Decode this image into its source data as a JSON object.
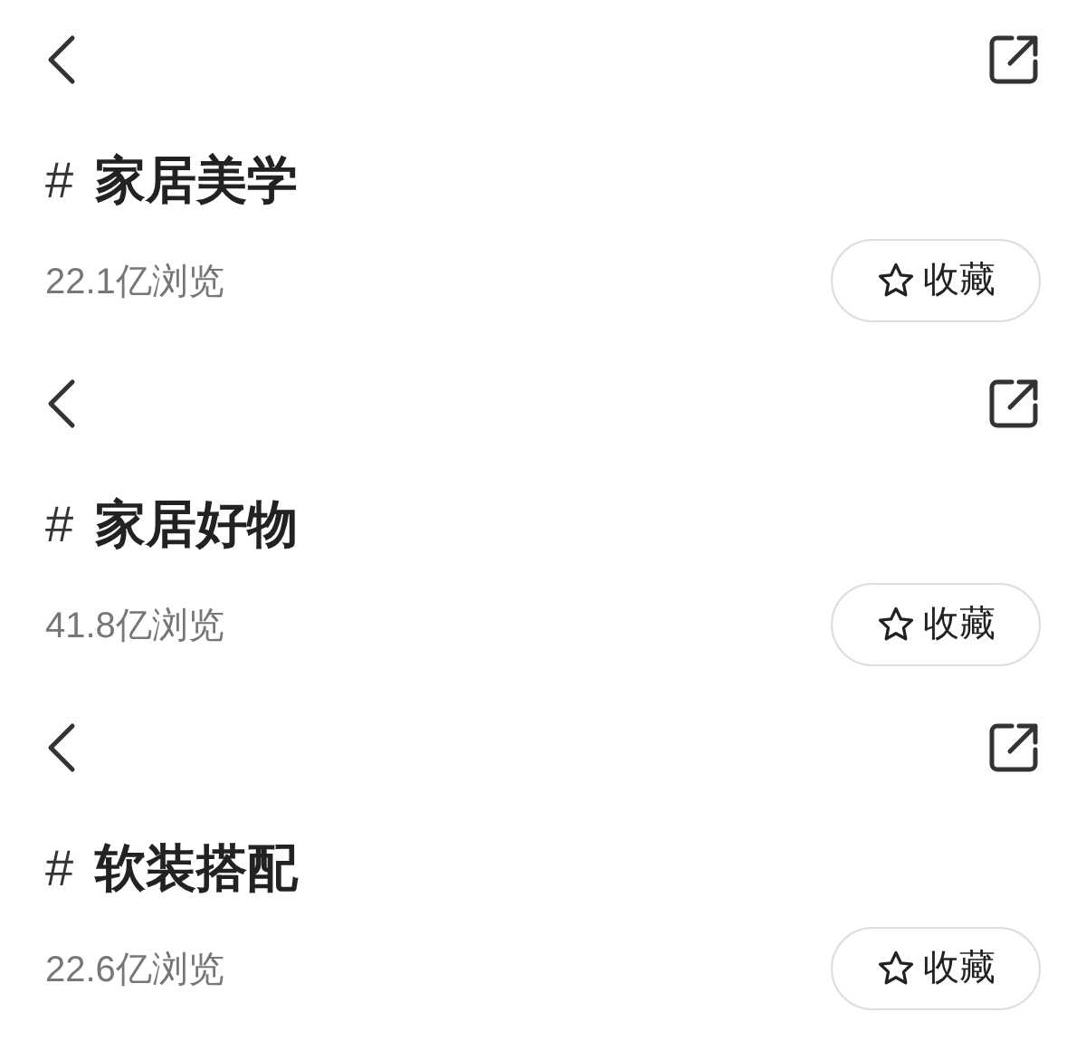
{
  "topics": [
    {
      "hash": "#",
      "title": "家居美学",
      "views": "22.1亿浏览",
      "button": "收藏"
    },
    {
      "hash": "#",
      "title": "家居好物",
      "views": "41.8亿浏览",
      "button": "收藏"
    },
    {
      "hash": "#",
      "title": "软装搭配",
      "views": "22.6亿浏览",
      "button": "收藏"
    }
  ]
}
